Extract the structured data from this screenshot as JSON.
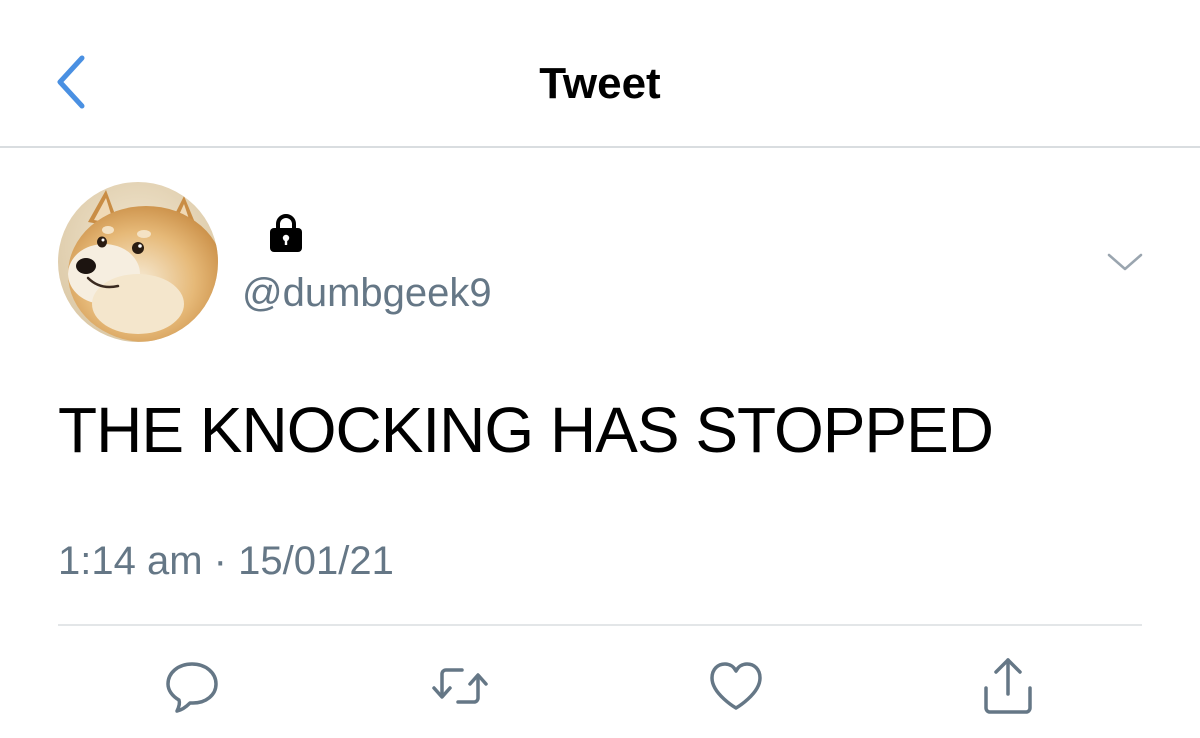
{
  "header": {
    "title": "Tweet",
    "back_icon": "chevron-left-icon",
    "accent_color": "#4a90e2"
  },
  "tweet": {
    "avatar": "doge-avatar",
    "protected_icon": "lock-icon",
    "handle": "@dumbgeek9",
    "menu_icon": "chevron-down-icon",
    "text": "THE KNOCKING HAS STOPPED",
    "time": "1:14 am",
    "separator": "·",
    "date": "15/01/21"
  },
  "actions": [
    {
      "name": "reply",
      "icon": "reply-icon"
    },
    {
      "name": "retweet",
      "icon": "retweet-icon"
    },
    {
      "name": "like",
      "icon": "heart-icon"
    },
    {
      "name": "share",
      "icon": "share-icon"
    }
  ],
  "colors": {
    "secondary_text": "#657786",
    "icon_gray": "#657786",
    "divider": "#e3e6e8"
  }
}
